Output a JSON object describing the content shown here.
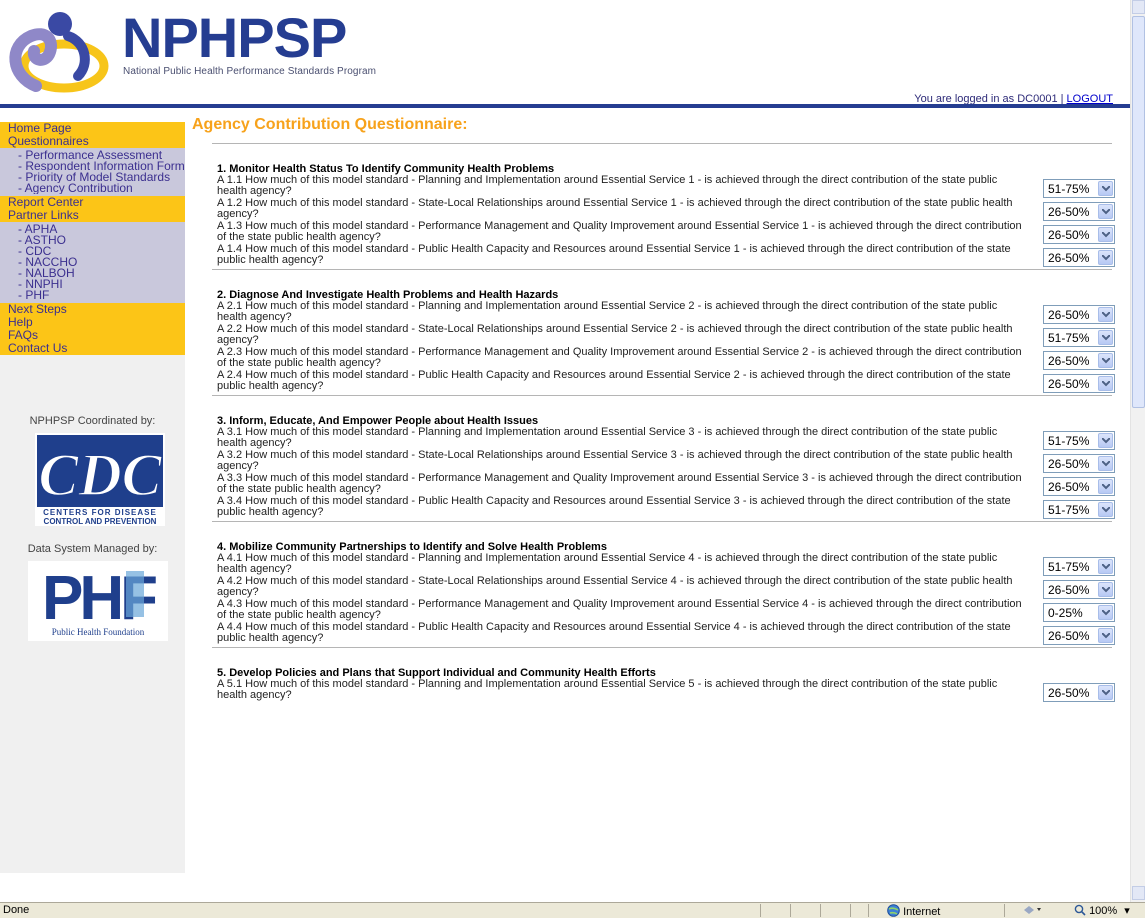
{
  "header": {
    "logo_text": "NPHPSP",
    "logo_subtitle": "National Public Health Performance Standards Program",
    "login_prefix": "You are logged in as DC0001 | ",
    "logout_label": "LOGOUT"
  },
  "sidebar": {
    "items": [
      {
        "label": "Home Page",
        "kind": "main"
      },
      {
        "label": "Questionnaires",
        "kind": "main"
      },
      {
        "label": "- Performance Assessment",
        "kind": "sub"
      },
      {
        "label": "- Respondent Information Form",
        "kind": "sub"
      },
      {
        "label": "- Priority of Model Standards",
        "kind": "sub"
      },
      {
        "label": "- Agency Contribution",
        "kind": "sub"
      },
      {
        "label": "Report Center",
        "kind": "main"
      },
      {
        "label": "Partner Links",
        "kind": "main"
      },
      {
        "label": "- APHA",
        "kind": "sub"
      },
      {
        "label": "- ASTHO",
        "kind": "sub"
      },
      {
        "label": "- CDC",
        "kind": "sub"
      },
      {
        "label": "- NACCHO",
        "kind": "sub"
      },
      {
        "label": "- NALBOH",
        "kind": "sub"
      },
      {
        "label": "- NNPHI",
        "kind": "sub"
      },
      {
        "label": "- PHF",
        "kind": "sub"
      },
      {
        "label": "Next Steps",
        "kind": "main"
      },
      {
        "label": "Help",
        "kind": "main"
      },
      {
        "label": "FAQs",
        "kind": "main"
      },
      {
        "label": "Contact Us",
        "kind": "main"
      }
    ],
    "coordinated_label": "NPHPSP Coordinated by:",
    "cdc_logo_text": "CDC",
    "cdc_caption_line1": "CENTERS FOR DISEASE",
    "cdc_caption_line2": "CONTROL AND PREVENTION",
    "managed_label": "Data System Managed by:",
    "phf_logo_text": "PHF",
    "phf_caption": "Public Health Foundation"
  },
  "main": {
    "title": "Agency Contribution Questionnaire:",
    "sections": [
      {
        "heading": "1. Monitor Health Status To Identify Community Health Problems",
        "questions": [
          {
            "text": "A 1.1 How much of this model standard - Planning and Implementation around Essential Service 1 - is achieved through the direct contribution of the state public health agency?",
            "value": "51-75%"
          },
          {
            "text": "A 1.2 How much of this model standard - State-Local Relationships around Essential Service 1 - is achieved through the direct contribution of the state public health agency?",
            "value": "26-50%"
          },
          {
            "text": "A 1.3 How much of this model standard - Performance Management and Quality Improvement around Essential Service 1 - is achieved through the direct contribution of the state public health agency?",
            "value": "26-50%"
          },
          {
            "text": "A 1.4 How much of this model standard - Public Health Capacity and Resources around Essential Service 1 - is achieved through the direct contribution of the state public health agency?",
            "value": "26-50%"
          }
        ]
      },
      {
        "heading": "2. Diagnose And Investigate Health Problems and Health Hazards",
        "questions": [
          {
            "text": "A 2.1 How much of this model standard - Planning and Implementation around Essential Service 2 - is achieved through the direct contribution of the state public health agency?",
            "value": "26-50%"
          },
          {
            "text": "A 2.2 How much of this model standard - State-Local Relationships around Essential Service 2 - is achieved through the direct contribution of the state public health agency?",
            "value": "51-75%"
          },
          {
            "text": "A 2.3 How much of this model standard - Performance Management and Quality Improvement around Essential Service 2 - is achieved through the direct contribution of the state public health agency?",
            "value": "26-50%"
          },
          {
            "text": "A 2.4 How much of this model standard - Public Health Capacity and Resources around Essential Service 2 - is achieved through the direct contribution of the state public health agency?",
            "value": "26-50%"
          }
        ]
      },
      {
        "heading": "3. Inform, Educate, And Empower People about Health Issues",
        "questions": [
          {
            "text": "A 3.1 How much of this model standard - Planning and Implementation around Essential Service 3 - is achieved through the direct contribution of the state public health agency?",
            "value": "51-75%"
          },
          {
            "text": "A 3.2 How much of this model standard - State-Local Relationships around Essential Service 3 - is achieved through the direct contribution of the state public health agency?",
            "value": "26-50%"
          },
          {
            "text": "A 3.3 How much of this model standard - Performance Management and Quality Improvement around Essential Service 3 - is achieved through the direct contribution of the state public health agency?",
            "value": "26-50%"
          },
          {
            "text": "A 3.4 How much of this model standard - Public Health Capacity and Resources around Essential Service 3 - is achieved through the direct contribution of the state public health agency?",
            "value": "51-75%"
          }
        ]
      },
      {
        "heading": "4. Mobilize Community Partnerships to Identify and Solve Health Problems",
        "questions": [
          {
            "text": "A 4.1 How much of this model standard - Planning and Implementation around Essential Service 4 - is achieved through the direct contribution of the state public health agency?",
            "value": "51-75%"
          },
          {
            "text": "A 4.2 How much of this model standard - State-Local Relationships around Essential Service 4 - is achieved through the direct contribution of the state public health agency?",
            "value": "26-50%"
          },
          {
            "text": "A 4.3 How much of this model standard - Performance Management and Quality Improvement around Essential Service 4 - is achieved through the direct contribution of the state public health agency?",
            "value": "0-25%"
          },
          {
            "text": "A 4.4 How much of this model standard - Public Health Capacity and Resources around Essential Service 4 - is achieved through the direct contribution of the state public health agency?",
            "value": "26-50%"
          }
        ]
      },
      {
        "heading": "5. Develop Policies and Plans that Support Individual and Community Health Efforts",
        "questions": [
          {
            "text": "A 5.1 How much of this model standard - Planning and Implementation around Essential Service 5 - is achieved through the direct contribution of the state public health agency?",
            "value": "26-50%"
          }
        ]
      }
    ]
  },
  "statusbar": {
    "status": "Done",
    "zone": "Internet",
    "zoom": "100%"
  },
  "colors": {
    "brand_blue": "#253d91",
    "nav_yellow": "#fcc517",
    "nav_lavender": "#c9c8dc",
    "title_orange": "#f7a21b"
  }
}
